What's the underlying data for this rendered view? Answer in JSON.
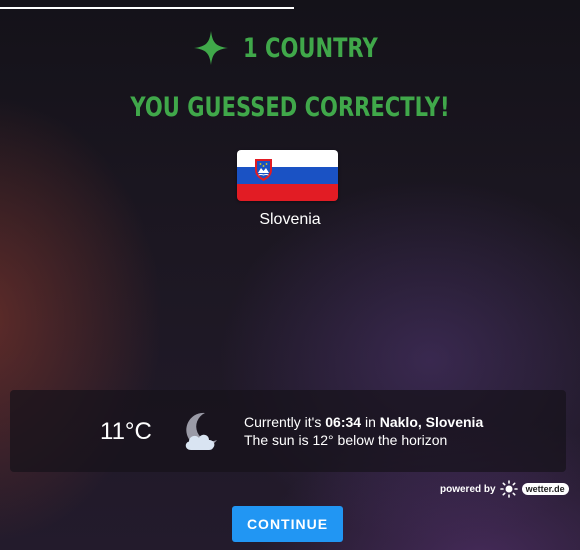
{
  "header": {
    "count_label": "1 COUNTRY",
    "result_label": "YOU GUESSED CORRECTLY!",
    "accent_color": "#40a84a",
    "progress": 0.5
  },
  "country": {
    "name": "Slovenia",
    "flag_colors": [
      "#ffffff",
      "#1a52c4",
      "#e21c24"
    ]
  },
  "weather": {
    "temperature": "11°C",
    "icon": "moon-cloud-icon",
    "line1_prefix": "Currently it's ",
    "time": "06:34",
    "line1_mid": " in ",
    "location": "Naklo, Slovenia",
    "line2": "The sun is 12° below the horizon"
  },
  "powered": {
    "label": "powered by",
    "brand": "wetter.de"
  },
  "continue_label": "CONTINUE"
}
